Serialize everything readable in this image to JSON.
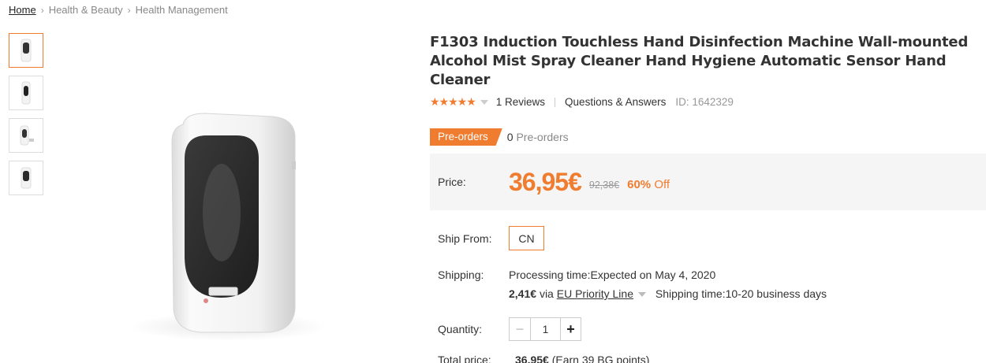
{
  "breadcrumb": {
    "items": [
      "Home",
      "Health & Beauty",
      "Health Management"
    ]
  },
  "product": {
    "title": "F1303 Induction Touchless Hand Disinfection Machine Wall-mounted Alcohol Mist Spray Cleaner Hand Hygiene Automatic Sensor Hand Cleaner",
    "rating_stars": "★★★★★",
    "rating_value": 5,
    "reviews": "1 Reviews",
    "qa": "Questions & Answers",
    "id_text": "ID: 1642329"
  },
  "preorder": {
    "tag": "Pre-orders",
    "count": "0",
    "count_label": "Pre-orders"
  },
  "price": {
    "label": "Price:",
    "current": "36,95€",
    "original": "92,38€",
    "discount_pct": "60%",
    "discount_word": "Off"
  },
  "ship_from": {
    "label": "Ship From:",
    "option": "CN"
  },
  "shipping": {
    "label": "Shipping:",
    "processing": "Processing time:Expected on May 4, 2020",
    "cost": "2,41€",
    "via": "via",
    "method": "EU Priority Line",
    "time": "Shipping time:10-20 business days"
  },
  "quantity": {
    "label": "Quantity:",
    "value": "1",
    "minus": "−",
    "plus": "+"
  },
  "total": {
    "label": "Total price:",
    "value": "36,95€",
    "points": "(Earn 39 BG points)"
  },
  "colors": {
    "accent": "#f07c30",
    "price_bg": "#f5f5f5"
  }
}
